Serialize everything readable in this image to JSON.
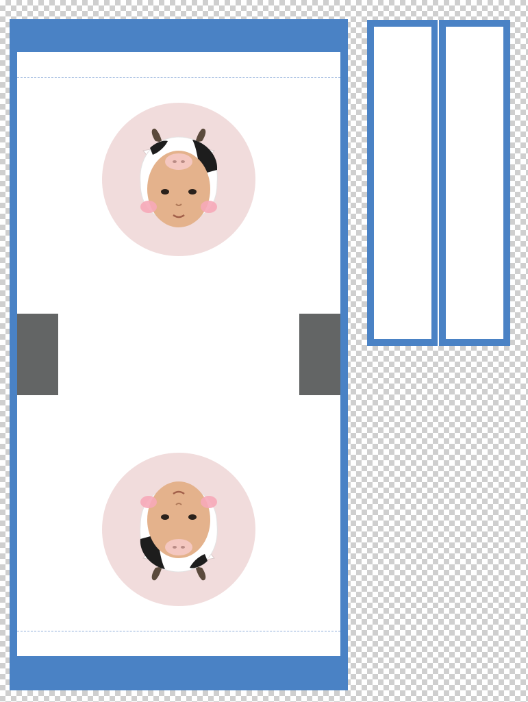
{
  "canvas": {
    "background": "transparent-checkerboard"
  },
  "colors": {
    "frame_blue": "#4a82c5",
    "flap_gray": "#636565",
    "circle_pink": "#f1dcdc",
    "guide_line": "#8aaad8"
  },
  "template": {
    "main_panel": "blue-bordered-strip",
    "flaps": [
      "left-flap",
      "right-flap"
    ],
    "side_strips": [
      "strip-1",
      "strip-2"
    ]
  },
  "images": [
    {
      "name": "baby-cow-hood-photo",
      "orientation": "upright"
    },
    {
      "name": "baby-cow-hood-photo",
      "orientation": "rotated-180"
    }
  ]
}
